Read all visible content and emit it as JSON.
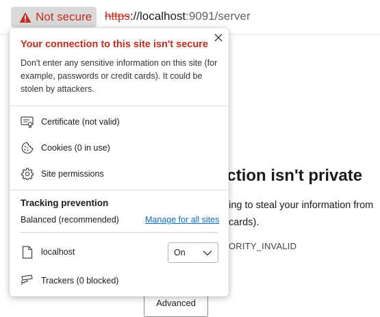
{
  "addressbar": {
    "security_label": "Not secure",
    "url_scheme": "https",
    "url_host": "://localhost",
    "url_rest": ":9091/server"
  },
  "background_page": {
    "heading": "ection isn't private",
    "line1": "trying to steal your information from",
    "line2": "cards).",
    "error_code": "ORITY_INVALID",
    "advanced_button": "Advanced"
  },
  "flyout": {
    "title": "Your connection to this site isn't secure",
    "description": "Don't enter any sensitive information on this site (for example, passwords or credit cards). It could be stolen by attackers.",
    "items": [
      {
        "label": "Certificate (not valid)",
        "icon": "certificate-icon"
      },
      {
        "label": "Cookies (0 in use)",
        "icon": "cookie-icon"
      },
      {
        "label": "Site permissions",
        "icon": "gear-icon"
      }
    ],
    "tracking": {
      "title": "Tracking prevention",
      "level": "Balanced (recommended)",
      "manage_link": "Manage for all sites",
      "site": "localhost",
      "select_value": "On",
      "trackers": "Trackers (0 blocked)"
    }
  },
  "colors": {
    "warning_red": "#c42b1c",
    "link_blue": "#0f6cbd",
    "chip_bg": "#d9d9d9"
  }
}
